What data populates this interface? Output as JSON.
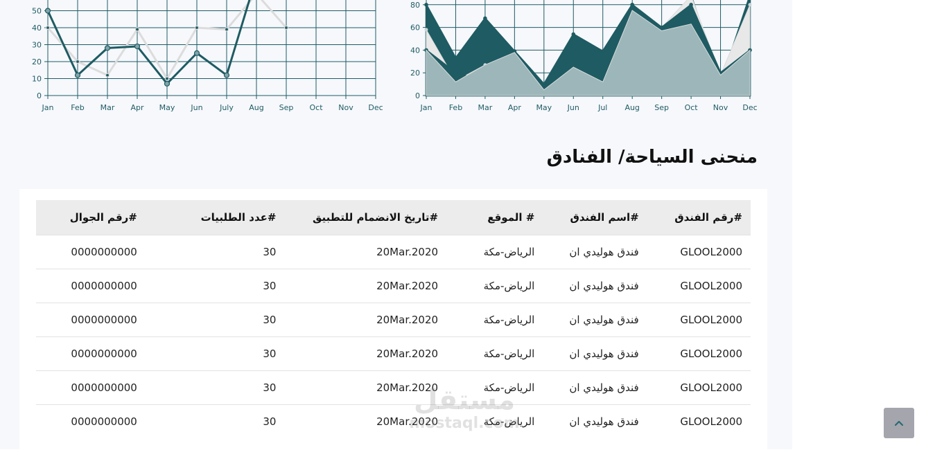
{
  "charts": {
    "line": {
      "type": "line",
      "categories": [
        "Jan",
        "Feb",
        "Mar",
        "Apr",
        "May",
        "Jun",
        "July",
        "Aug",
        "Sep",
        "Oct",
        "Nov",
        "Dec"
      ],
      "y_ticks": [
        0,
        10,
        20,
        30,
        40,
        50
      ],
      "series": [
        {
          "values": [
            40,
            20,
            12,
            39,
            10,
            40,
            39,
            60,
            40,
            null,
            null,
            null
          ],
          "color": "#dcdcdc"
        },
        {
          "values": [
            50,
            12,
            28,
            29,
            7,
            25,
            12,
            70,
            null,
            null,
            null,
            null
          ],
          "color": "#1f5b63"
        }
      ]
    },
    "area": {
      "type": "area",
      "categories": [
        "Jan",
        "Feb",
        "Mar",
        "Apr",
        "May",
        "Jun",
        "Jul",
        "Aug",
        "Sep",
        "Oct",
        "Nov",
        "Dec"
      ],
      "y_ticks": [
        0,
        20,
        40,
        60,
        80
      ],
      "series": [
        {
          "values": [
            80,
            33,
            68,
            39,
            10,
            54,
            39,
            80,
            40,
            88,
            10,
            88
          ],
          "color": "#1f5b63"
        },
        {
          "values": [
            58,
            13,
            27,
            30,
            8,
            32,
            20,
            78,
            60,
            88,
            18,
            80
          ],
          "color": "#e8e8e8"
        },
        {
          "values": [
            40,
            20,
            12,
            39,
            10,
            40,
            39,
            80,
            60,
            80,
            20,
            40
          ],
          "color": "#1f5b63"
        },
        {
          "values": [
            40,
            12,
            27,
            38,
            5,
            25,
            12,
            75,
            57,
            63,
            18,
            40
          ],
          "color": "#9db6b9"
        }
      ]
    }
  },
  "section": {
    "title": "منحنى السياحة/ الفنادق"
  },
  "table": {
    "headers": {
      "ref": "#رقم الفندق",
      "name": "#اسم الفندق",
      "location": "# الموقع",
      "joined": "#تاريخ الانضمام للتطبيق",
      "orders": "#عدد الطلبيات",
      "phone": "#رقم الجوال"
    },
    "rows": [
      {
        "ref": "GLOOL2000",
        "name": "فندق هوليدي ان",
        "location": "الرياض-مكة",
        "joined": "20Mar.2020",
        "orders": "30",
        "phone": "0000000000"
      },
      {
        "ref": "GLOOL2000",
        "name": "فندق هوليدي ان",
        "location": "الرياض-مكة",
        "joined": "20Mar.2020",
        "orders": "30",
        "phone": "0000000000"
      },
      {
        "ref": "GLOOL2000",
        "name": "فندق هوليدي ان",
        "location": "الرياض-مكة",
        "joined": "20Mar.2020",
        "orders": "30",
        "phone": "0000000000"
      },
      {
        "ref": "GLOOL2000",
        "name": "فندق هوليدي ان",
        "location": "الرياض-مكة",
        "joined": "20Mar.2020",
        "orders": "30",
        "phone": "0000000000"
      },
      {
        "ref": "GLOOL2000",
        "name": "فندق هوليدي ان",
        "location": "الرياض-مكة",
        "joined": "20Mar.2020",
        "orders": "30",
        "phone": "0000000000"
      },
      {
        "ref": "GLOOL2000",
        "name": "فندق هوليدي ان",
        "location": "الرياض-مكة",
        "joined": "20Mar.2020",
        "orders": "30",
        "phone": "0000000000"
      }
    ]
  },
  "watermark": {
    "arabic": "مستقل",
    "latin": "mostaql.com"
  },
  "scroll_top": {
    "icon": "chevron-up-icon",
    "glyph": "⌃"
  }
}
